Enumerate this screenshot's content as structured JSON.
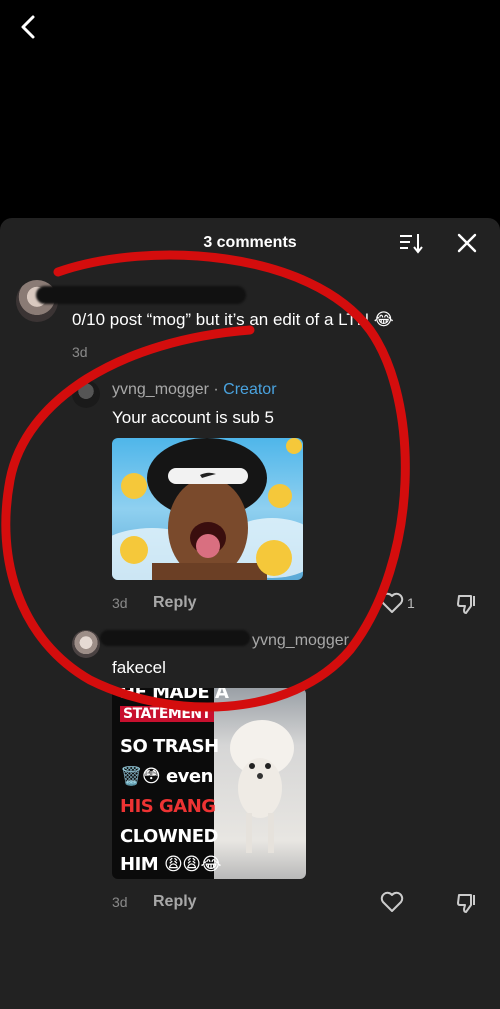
{
  "header": {
    "back_icon": "chevron-left-icon"
  },
  "sheet": {
    "title": "3 comments",
    "sort_icon": "sort-icon",
    "close_icon": "close-icon"
  },
  "comments": [
    {
      "text": "0/10 post “mog” but it’s an edit of a LTN 😂",
      "time": "3d"
    },
    {
      "username": "yvng_mogger",
      "separator": " · ",
      "badge": "Creator",
      "text": "Your account is sub 5",
      "time": "3d",
      "reply_label": "Reply",
      "likes": "1"
    },
    {
      "username": "yvng_mogger",
      "text": "fakecel",
      "time": "3d",
      "reply_label": "Reply",
      "image_text": [
        "HE MADE A",
        "STATEMENT",
        "SO TRASH",
        "🗑️😳 even",
        "HIS GANG",
        "CLOWNED",
        "HIM 😩😩😂"
      ]
    }
  ],
  "colors": {
    "accent": "#4aa3df",
    "annotation": "#d40d0d",
    "sheet_bg": "#222222"
  }
}
